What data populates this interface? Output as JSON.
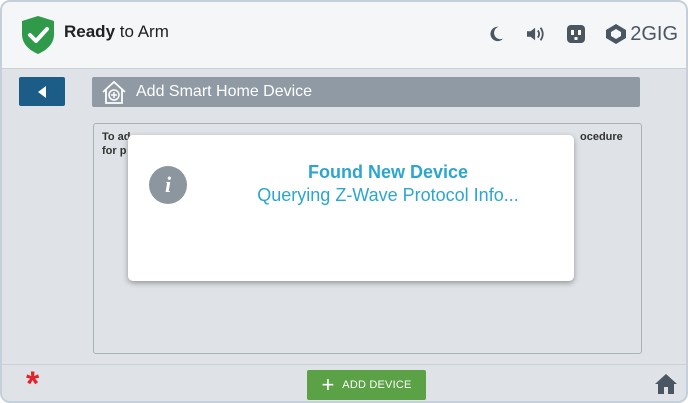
{
  "status": {
    "bold": "Ready",
    "rest": " to Arm",
    "shield_color": "#2e9a4a",
    "icons": [
      "moon-icon",
      "speaker-icon",
      "outlet-icon"
    ],
    "brand": "2GIG"
  },
  "header": {
    "back_icon": "left-triangle-icon",
    "title": "Add Smart Home Device"
  },
  "panel": {
    "instructions_line1": "To ad",
    "instructions_line1_right": "ocedure",
    "instructions_line2": "for p"
  },
  "dialog": {
    "title": "Found New Device",
    "message": "Querying Z-Wave Protocol Info...",
    "icon": "i"
  },
  "bottom": {
    "add_label": "ADD DEVICE",
    "add_symbol": "+",
    "asterisk": "*"
  },
  "colors": {
    "accent": "#2ca6cf",
    "primary_button": "#1b5d86",
    "add_button": "#5aa245",
    "alert": "#e2232a"
  }
}
